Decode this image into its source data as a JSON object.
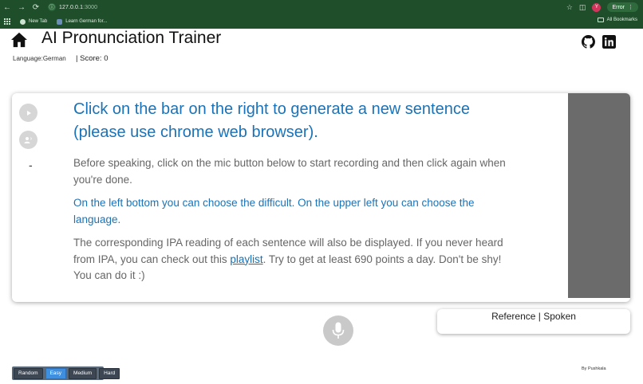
{
  "browser": {
    "url_host": "127.0.0.1",
    "url_port": ":3000",
    "profile_initial": "Y",
    "error_label": "Error",
    "bookmarks": [
      {
        "label": "New Tab",
        "icon": "globe-icon"
      },
      {
        "label": "Learn German for...",
        "icon": "site-icon"
      }
    ],
    "all_bookmarks_label": "All Bookmarks"
  },
  "header": {
    "title": "AI Pronunciation Trainer",
    "language_label": "Language:German",
    "score_label": "| Score: 0"
  },
  "card": {
    "headline": "Click on the bar on the right to generate a new sentence (please use chrome web browser).",
    "paragraph1": "Before speaking, click on the mic button below to start recording and then click again when you're done.",
    "paragraph2": "On the left bottom you can choose the difficult. On the upper left you can choose the language.",
    "paragraph3_before": "The corresponding IPA reading of each sentence will also be displayed. If you never heard from IPA, you can check out this ",
    "paragraph3_link": "playlist",
    "paragraph3_after": ". Try to get at least 690 points a day. Don't be shy! You can do it :)",
    "side_text": "-"
  },
  "reference": {
    "label": "Reference | Spoken"
  },
  "difficulty": {
    "options": [
      "Random",
      "Easy",
      "Medium",
      "Hard"
    ],
    "selected": "Easy"
  },
  "footer": {
    "byline": "By Pushkala"
  },
  "colors": {
    "chrome_bg": "#1f4e2a",
    "headline_blue": "#1a73b8",
    "body_gray": "#666666",
    "right_bar": "#6b6b6b",
    "active_button": "#3e8fe0"
  }
}
